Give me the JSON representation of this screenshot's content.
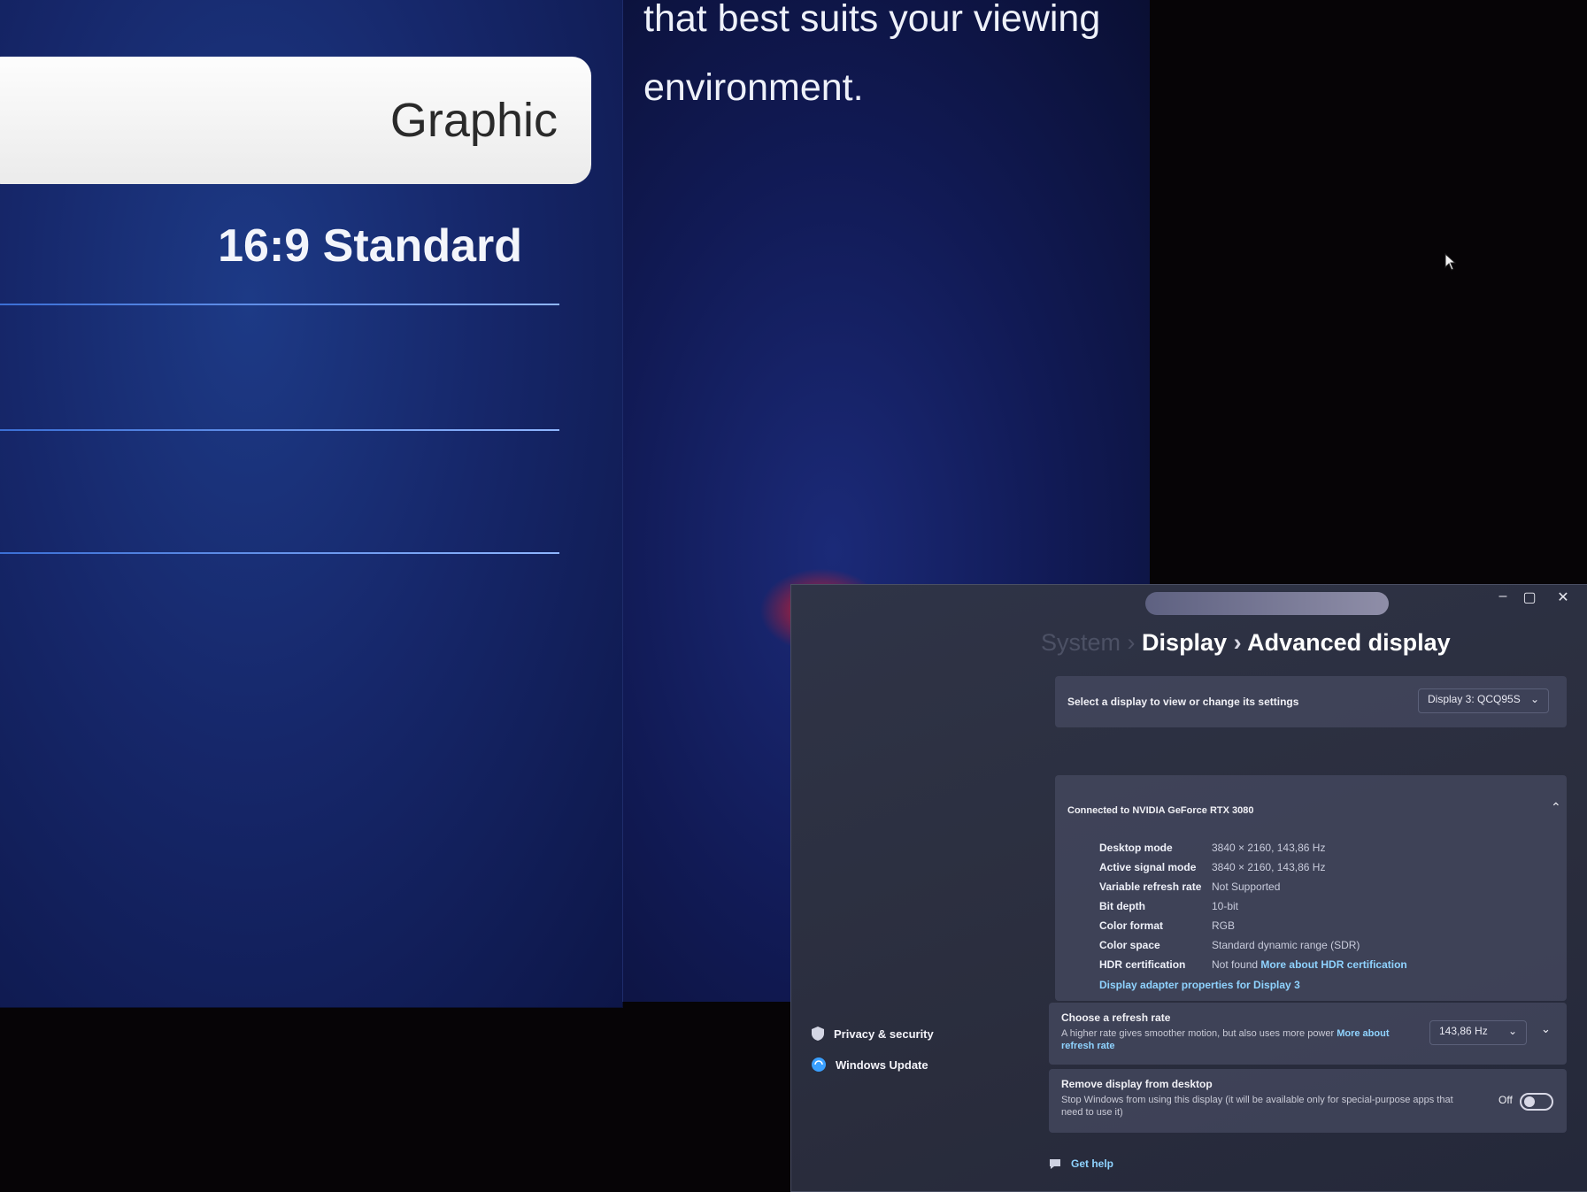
{
  "tv_menu": {
    "selected_option": "Graphic",
    "option_2": "16:9 Standard"
  },
  "tv_description": {
    "text_line_1": "that best suits your viewing",
    "text_line_2": "environment."
  },
  "settings_window": {
    "controls": {
      "minimize": "–",
      "maximize": "▢",
      "close": "✕"
    },
    "breadcrumb": {
      "root": "System",
      "parent": "Display",
      "current": "Advanced display"
    },
    "select_display": {
      "label": "Select a display to view or change its settings",
      "value": "Display 3: QCQ95S"
    },
    "display_info": {
      "connected_to": "Connected to NVIDIA GeForce RTX 3080",
      "rows": [
        {
          "key": "Desktop mode",
          "value": "3840 × 2160, 143,86 Hz"
        },
        {
          "key": "Active signal mode",
          "value": "3840 × 2160, 143,86 Hz"
        },
        {
          "key": "Variable refresh rate",
          "value": "Not Supported"
        },
        {
          "key": "Bit depth",
          "value": "10-bit"
        },
        {
          "key": "Color format",
          "value": "RGB"
        },
        {
          "key": "Color space",
          "value": "Standard dynamic range (SDR)"
        },
        {
          "key": "HDR certification",
          "value": "Not found",
          "link": "More about HDR certification"
        }
      ],
      "adapter_link": "Display adapter properties for Display 3"
    },
    "refresh_rate": {
      "title": "Choose a refresh rate",
      "desc": "A higher rate gives smoother motion, but also uses more power",
      "link": "More about refresh rate",
      "value": "143,86 Hz"
    },
    "remove_display": {
      "title": "Remove display from desktop",
      "desc": "Stop Windows from using this display (it will be available only for special-purpose apps that need to use it)",
      "toggle_label": "Off"
    },
    "sidebar": [
      {
        "label": "Privacy & security",
        "icon": "shield-icon"
      },
      {
        "label": "Windows Update",
        "icon": "sync-icon"
      }
    ],
    "get_help": "Get help"
  }
}
